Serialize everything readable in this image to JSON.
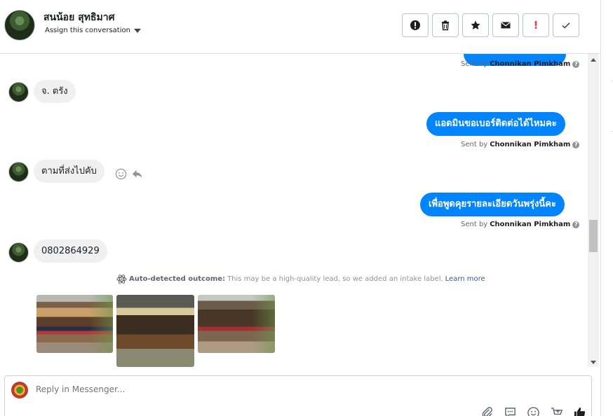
{
  "header": {
    "contact_name": "สนน้อย สุทธิมาศ",
    "assign_label": "Assign this conversation",
    "actions": [
      {
        "name": "alert-circle-icon"
      },
      {
        "name": "trash-icon"
      },
      {
        "name": "star-icon"
      },
      {
        "name": "envelope-icon"
      },
      {
        "name": "exclamation-icon",
        "text": "!"
      },
      {
        "name": "check-icon"
      }
    ]
  },
  "thread": {
    "sent_by_prefix": "Sent by",
    "agent_name": "Chonnikan Pimkham",
    "messages": [
      {
        "direction": "in",
        "text": "จ.  ตรัง"
      },
      {
        "direction": "out",
        "text": "แอดมินขอเบอร์ติดต่อได้ไหมคะ"
      },
      {
        "direction": "in",
        "text": "ตามที่ส่งไปคับ"
      },
      {
        "direction": "out",
        "text": "เพื่อพูดคุยรายละเอียดวันพรุ่งนี้คะ"
      },
      {
        "direction": "in",
        "text": "0802864929"
      }
    ],
    "auto_detected": {
      "label": "Auto-detected outcome:",
      "text": "This may be a high-quality lead, so we added an intake label.",
      "link": "Learn more"
    }
  },
  "composer": {
    "placeholder": "Reply in Messenger..."
  },
  "colors": {
    "accent": "#0084ff",
    "incoming_bubble": "#f0f0f0"
  }
}
